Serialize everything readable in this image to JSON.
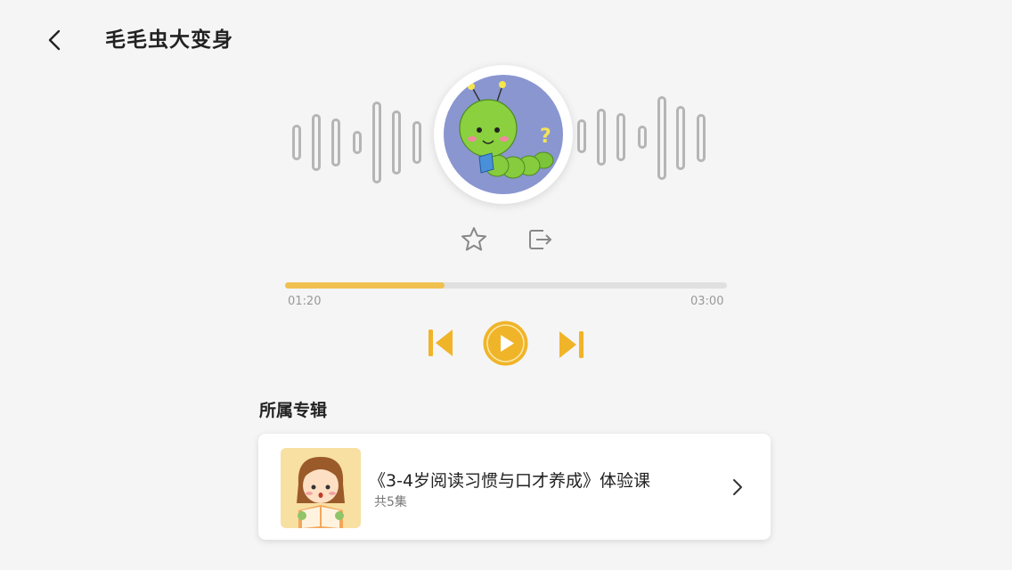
{
  "header": {
    "title": "毛毛虫大变身",
    "back_icon": "back-arrow-icon"
  },
  "player": {
    "cover_icon": "caterpillar-illustration",
    "favorite_icon": "star-icon",
    "share_icon": "share-exit-icon",
    "current_time": "01:20",
    "total_time": "03:00",
    "progress": 0.36,
    "controls": {
      "prev_icon": "skip-previous-icon",
      "play_icon": "play-icon",
      "next_icon": "skip-next-icon"
    }
  },
  "album": {
    "section_title": "所属专辑",
    "name": "《3-4岁阅读习惯与口才养成》体验课",
    "count": "共5集",
    "thumb_icon": "girl-reading-illustration",
    "chevron_icon": "chevron-right-icon"
  },
  "colors": {
    "accent": "#f0c150",
    "play_button": "#f0b429",
    "cover_bg": "#8a96d0",
    "thumb_bg": "#f8dfa2",
    "wave": "#b5b5b5"
  }
}
